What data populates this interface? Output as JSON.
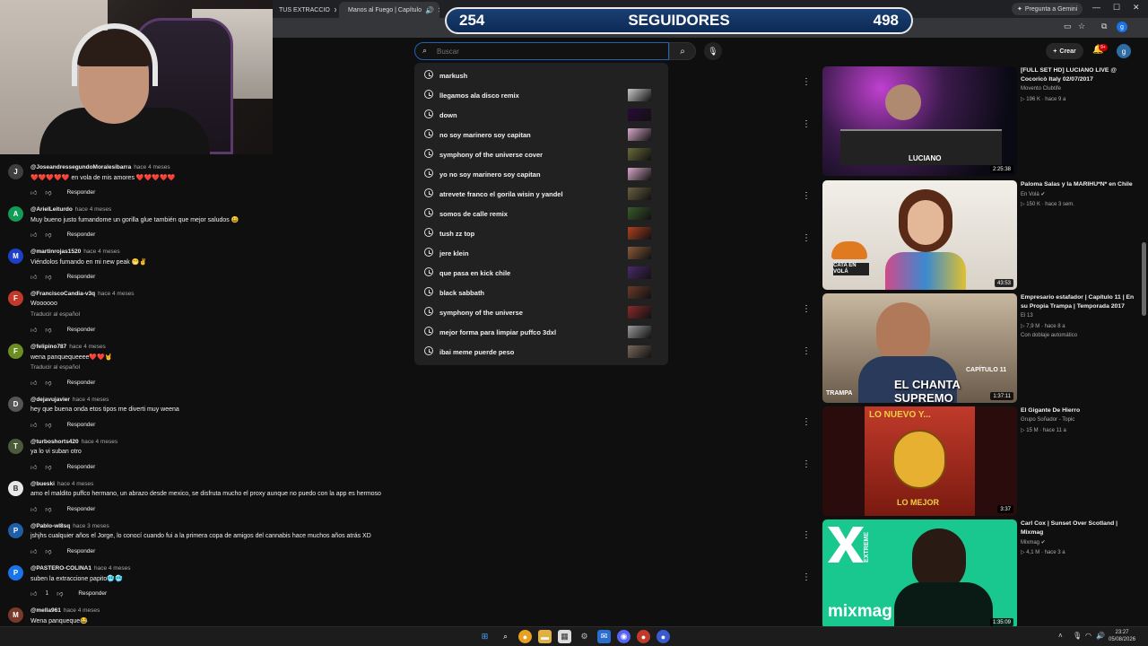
{
  "browser": {
    "tabs": [
      {
        "label": "TUS EXTRACCIO"
      },
      {
        "label": "Manos al Fuego | Capítulo"
      }
    ],
    "gemini_label": "Pregunta a Gemini",
    "profile_initial": "g"
  },
  "overlay": {
    "left_count": "254",
    "label": "SEGUIDORES",
    "right_count": "498"
  },
  "search": {
    "placeholder": "Buscar",
    "suggestions": [
      {
        "text": "markush",
        "thumb": false
      },
      {
        "text": "llegamos ala disco remix",
        "thumb": true,
        "color": "#c9c9c9"
      },
      {
        "text": "down",
        "thumb": true,
        "color": "#2a0a3a"
      },
      {
        "text": "no soy marinero soy capitan",
        "thumb": true,
        "color": "#d8a8c8"
      },
      {
        "text": "symphony of the universe cover",
        "thumb": true,
        "color": "#6a6a3a"
      },
      {
        "text": "yo no soy marinero soy capitan",
        "thumb": true,
        "color": "#d8a8c8"
      },
      {
        "text": "atrevete franco el gorila wisin y yandel",
        "thumb": true,
        "color": "#6a6040"
      },
      {
        "text": "somos de calle remix",
        "thumb": true,
        "color": "#3a5a2a"
      },
      {
        "text": "tush zz top",
        "thumb": true,
        "color": "#b04020"
      },
      {
        "text": "jere klein",
        "thumb": true,
        "color": "#8a5a3a"
      },
      {
        "text": "que pasa en kick chile",
        "thumb": true,
        "color": "#4a2a6a"
      },
      {
        "text": "black sabbath",
        "thumb": true,
        "color": "#6a3a2a"
      },
      {
        "text": "symphony of the universe",
        "thumb": true,
        "color": "#8a2a2a"
      },
      {
        "text": "mejor forma para limpiar puffco 3dxl",
        "thumb": true,
        "color": "#9a9a9a"
      },
      {
        "text": "ibai meme puerde peso",
        "thumb": true,
        "color": "#7a6a5a"
      }
    ]
  },
  "header": {
    "create_label": "Crear",
    "notif_badge": "9+",
    "account_initial": "g"
  },
  "comments": [
    {
      "user": "@JoseandressegundoMoralesibarra",
      "time": "hace 4 meses",
      "text": "❤️❤️❤️❤️❤️ en vola de mis amores ❤️❤️❤️❤️❤️",
      "avatar": "J",
      "avatar_color": "#3f3f3f",
      "translate": "",
      "likes": "",
      "reply": "Responder"
    },
    {
      "user": "@ArielLeiturdo",
      "time": "hace 4 meses",
      "text": "Muy bueno justo fumandome  un gorilla glue también que mejor saludos 😀",
      "avatar": "A",
      "avatar_color": "#0f9d58",
      "translate": "",
      "likes": "",
      "reply": "Responder"
    },
    {
      "user": "@martinrojas1520",
      "time": "hace 4 meses",
      "text": "Viéndolos fumando en mi new peak 😁✌️",
      "avatar": "M",
      "avatar_color": "#1e40c8",
      "translate": "",
      "likes": "",
      "reply": "Responder"
    },
    {
      "user": "@FranciscoCandia-v3q",
      "time": "hace 4 meses",
      "text": "Woooooo",
      "avatar": "F",
      "avatar_color": "#c0392b",
      "translate": "Traducir al español",
      "likes": "",
      "reply": "Responder"
    },
    {
      "user": "@felipino787",
      "time": "hace 4 meses",
      "text": "wena panquequeeee❤️❤️🤘",
      "avatar": "F",
      "avatar_color": "#6b8e23",
      "translate": "Traducir al español",
      "likes": "",
      "reply": "Responder"
    },
    {
      "user": "@dejavujavier",
      "time": "hace 4 meses",
      "text": "hey que buena onda etos tipos me diverti muy weena",
      "avatar": "D",
      "avatar_color": "#555555",
      "translate": "",
      "likes": "",
      "reply": "Responder"
    },
    {
      "user": "@turboshorts420",
      "time": "hace 4 meses",
      "text": "ya lo vi suban otro",
      "avatar": "T",
      "avatar_color": "#4a5a3a",
      "translate": "",
      "likes": "",
      "reply": "Responder"
    },
    {
      "user": "@bueski",
      "time": "hace 4 meses",
      "text": "amo el maldito puffco hermano, un abrazo desde mexico, se disfruta mucho el proxy aunque no puedo con la app es hermoso",
      "avatar": "B",
      "avatar_color": "#e8e8e8",
      "translate": "",
      "likes": "",
      "reply": "Responder"
    },
    {
      "user": "@Pablo-wl8sq",
      "time": "hace 3 meses",
      "text": "jshjhs cualquier años el Jorge, lo conocí cuando fui a la primera copa de amigos del cannabis hace muchos años atrás XD",
      "avatar": "P",
      "avatar_color": "#1f5fa8",
      "translate": "",
      "likes": "",
      "reply": "Responder"
    },
    {
      "user": "@PASTERO-COLINA1",
      "time": "hace 4 meses",
      "text": "suben la extraccione papito🥶🥶",
      "avatar": "P",
      "avatar_color": "#1a73e8",
      "translate": "",
      "likes": "1",
      "reply": "Responder"
    },
    {
      "user": "@mella961",
      "time": "hace 4 meses",
      "text": "Wena panqueque😂",
      "avatar": "M",
      "avatar_color": "#7a3a2a",
      "translate": "",
      "likes": "",
      "reply": "Responder"
    }
  ],
  "recommendations": [
    {
      "title": "[FULL SET HD] LUCIANO LIVE @ Cocoricò Italy 02/07/2017",
      "channel": "Movento Clubtife",
      "meta": "▷ 196 K · hace 9 a",
      "duration": "2:25:38",
      "tag": "",
      "bg": "#2a1a3a",
      "accent": "#d040c0"
    },
    {
      "title": "Paloma Salas y la MARIHU*N* en Chile",
      "channel": "En Volá ✔",
      "meta": "▷ 150 K · hace 3 sem.",
      "duration": "43:53",
      "tag": "",
      "bg": "#e8e4de",
      "accent": "#2a7fd0"
    },
    {
      "title": "Empresario estafador | Capítulo 11 | En su Propia Trampa | Temporada 2017",
      "channel": "El 13",
      "meta": "▷ 7,9 M · hace 8 a",
      "duration": "1:37:11",
      "tag": "Con doblaje automático",
      "bg": "#8a7a6a",
      "accent": "#ffffff"
    },
    {
      "title": "El Gigante De Hierro",
      "channel": "Grupo Soñador - Topic",
      "meta": "▷ 15 M · hace 11 a",
      "duration": "3:37",
      "tag": "",
      "bg": "#c0392b",
      "accent": "#f0c040"
    },
    {
      "title": "Carl Cox | Sunset Over Scotland | Mixmag",
      "channel": "Mixmag ✔",
      "meta": "▷ 4,1 M · hace 3 a",
      "duration": "1:35:09",
      "tag": "",
      "bg": "#16c08a",
      "accent": "#0a3a2a"
    }
  ],
  "thumbnail_text": {
    "luciano": "LUCIANO",
    "cata": "CATA EN VOLÁ",
    "chanta": "EL CHANTA SUPREMO",
    "capitulo": "CAPÍTULO 11",
    "trampa": "TRAMPA",
    "lonuevo": "LO NUEVO Y...",
    "lomejor": "LO MEJOR",
    "extreme": "EXTREME",
    "mixmag": "mixmag"
  },
  "taskbar": {
    "time": "23:27",
    "date": "05/08/2026"
  },
  "colors": {
    "yt_bg": "#0f0f0f",
    "accent_blue": "#1c62b9",
    "overlay_bg": "#0c2a55"
  }
}
